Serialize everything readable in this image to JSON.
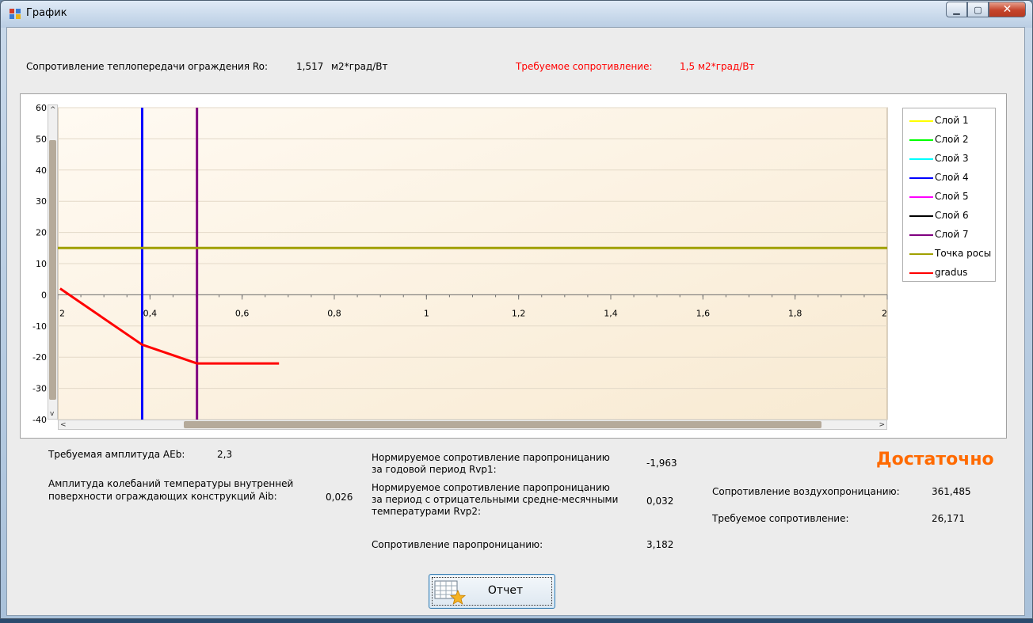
{
  "window": {
    "title": "График"
  },
  "header": {
    "ro_label": "Сопротивление теплопередачи ограждения Ro:",
    "ro_value": "1,517",
    "ro_unit": "м2*град/Вт",
    "req_label": "Требуемое сопротивление:",
    "req_value": "1,5",
    "req_unit": "м2*град/Вт"
  },
  "chart_data": {
    "type": "line",
    "xlim": [
      0.2,
      2
    ],
    "ylim": [
      -40,
      60
    ],
    "x_ticks": [
      "2",
      "0,4",
      "0,6",
      "0,8",
      "1",
      "1,2",
      "1,4",
      "1,6",
      "1,8",
      "2"
    ],
    "x_tick_values": [
      0.2,
      0.4,
      0.6,
      0.8,
      1.0,
      1.2,
      1.4,
      1.6,
      1.8,
      2.0
    ],
    "y_ticks": [
      "60",
      "50",
      "40",
      "30",
      "20",
      "10",
      "0",
      "-10",
      "-20",
      "-30",
      "-40"
    ],
    "y_tick_values": [
      60,
      50,
      40,
      30,
      20,
      10,
      0,
      -10,
      -20,
      -30,
      -40
    ],
    "legend_position": "right",
    "series": [
      {
        "name": "Слой 1",
        "color": "#ffff00",
        "type": "vertical",
        "x": null
      },
      {
        "name": "Слой 2",
        "color": "#00ff00",
        "type": "vertical",
        "x": null
      },
      {
        "name": "Слой 3",
        "color": "#00ffff",
        "type": "vertical",
        "x": null
      },
      {
        "name": "Слой 4",
        "color": "#0000ff",
        "type": "vertical",
        "x": 0.383
      },
      {
        "name": "Слой 5",
        "color": "#ff00ff",
        "type": "vertical",
        "x": null
      },
      {
        "name": "Слой 6",
        "color": "#000000",
        "type": "vertical",
        "x": null
      },
      {
        "name": "Слой 7",
        "color": "#800080",
        "type": "vertical",
        "x": 0.502
      },
      {
        "name": "Точка росы",
        "color": "#a0a000",
        "type": "horizontal",
        "y": 15
      },
      {
        "name": "gradus",
        "color": "#ff0000",
        "type": "line",
        "points": [
          [
            0.205,
            2
          ],
          [
            0.383,
            -16
          ],
          [
            0.502,
            -22
          ],
          [
            0.68,
            -22
          ]
        ]
      }
    ]
  },
  "stats": {
    "aeb_label": "Требуемая амплитуда AEb:",
    "aeb_value": "2,3",
    "aib_label_line1": "Амплитуда колебаний температуры внутренней",
    "aib_label_line2": "поверхности ограждающих конструкций Aib:",
    "aib_value": "0,026",
    "rvp1_line1": "Нормируемое сопротивление паропроницанию",
    "rvp1_line2": "за годовой период Rvp1:",
    "rvp1_value": "-1,963",
    "rvp2_line1": "Нормируемое сопротивление паропроницанию",
    "rvp2_line2": "за период с отрицательными средне-месячными",
    "rvp2_line3": "температурами Rvp2:",
    "rvp2_value": "0,032",
    "vp_label": "Сопротивление паропроницанию:",
    "vp_value": "3,182",
    "status": "Достаточно",
    "air_label": "Сопротивление воздухопроницанию:",
    "air_value": "361,485",
    "air_req_label": "Требуемое сопротивление:",
    "air_req_value": "26,171"
  },
  "buttons": {
    "report_label": "Отчет"
  },
  "colors": {
    "accent_red": "#ff0000",
    "status_orange": "#ff6a00",
    "plot_bg": "#fdf3e3"
  }
}
